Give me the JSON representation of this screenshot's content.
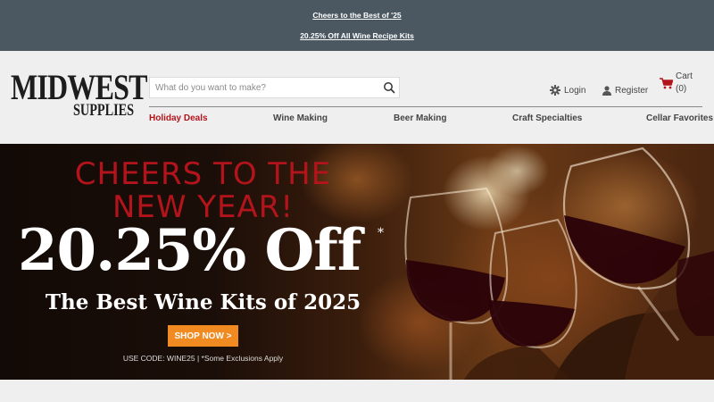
{
  "promo": {
    "line1": "Cheers to the Best of '25",
    "line2": "20.25% Off All Wine Recipe Kits"
  },
  "logo": {
    "main": "MIDWEST",
    "sub": "SUPPLIES"
  },
  "search": {
    "placeholder": "What do you want to make?",
    "icon": "search-icon"
  },
  "account": {
    "login_label": "Login",
    "register_label": "Register"
  },
  "cart": {
    "label": "Cart",
    "count": "(0)",
    "icon": "cart-icon"
  },
  "nav": {
    "items": [
      {
        "label": "Holiday Deals"
      },
      {
        "label": "Wine Making"
      },
      {
        "label": "Beer Making"
      },
      {
        "label": "Craft Specialties"
      },
      {
        "label": "Cellar Favorites"
      }
    ]
  },
  "hero": {
    "headline_line1": "CHEERS TO THE",
    "headline_line2": "NEW YEAR!",
    "discount": "20.25% Off",
    "asterisk": "*",
    "subtitle": "The Best Wine Kits of 2025",
    "cta_label": "SHOP NOW >",
    "fine_print": "USE CODE: WINE25 | *Some Exclusions Apply"
  },
  "colors": {
    "promo_bar": "#4b5862",
    "accent_red": "#b3141c",
    "cta_orange": "#f18a21",
    "header_bg": "#efefef"
  }
}
